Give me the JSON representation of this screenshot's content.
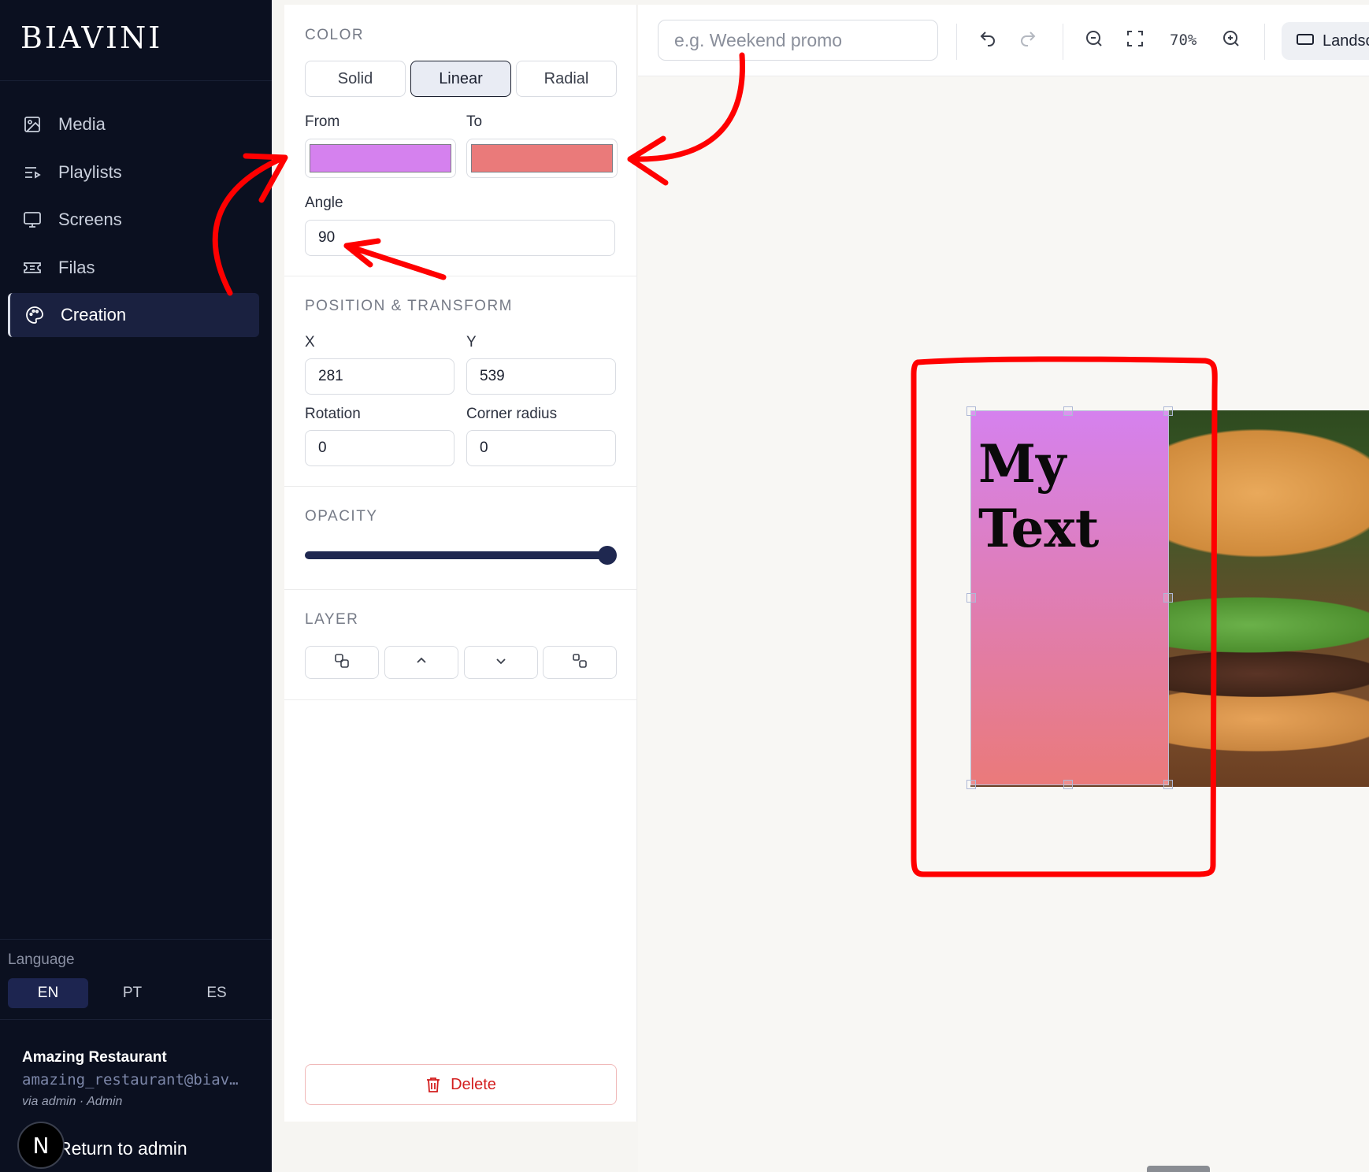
{
  "sidebar": {
    "logo": "BIAVINI",
    "items": [
      {
        "label": "Media",
        "icon": "image-icon"
      },
      {
        "label": "Playlists",
        "icon": "playlist-icon"
      },
      {
        "label": "Screens",
        "icon": "monitor-icon"
      },
      {
        "label": "Filas",
        "icon": "ticket-icon"
      },
      {
        "label": "Creation",
        "icon": "palette-icon",
        "active": true
      }
    ],
    "language": {
      "label": "Language",
      "options": [
        "EN",
        "PT",
        "ES"
      ],
      "selected": "EN"
    },
    "account": {
      "name": "Amazing Restaurant",
      "email": "amazing_restaurant@biav…",
      "role": "via admin · Admin"
    },
    "badge": "N",
    "return_label": "Return to admin"
  },
  "panel": {
    "color": {
      "title": "COLOR",
      "modes": [
        "Solid",
        "Linear",
        "Radial"
      ],
      "selected_mode": "Linear",
      "from_label": "From",
      "to_label": "To",
      "from_color": "#d581ee",
      "to_color": "#ea7a7a",
      "angle_label": "Angle",
      "angle_value": "90"
    },
    "transform": {
      "title": "POSITION & TRANSFORM",
      "x_label": "X",
      "x_value": "281",
      "y_label": "Y",
      "y_value": "539",
      "rotation_label": "Rotation",
      "rotation_value": "0",
      "radius_label": "Corner radius",
      "radius_value": "0"
    },
    "opacity": {
      "title": "OPACITY",
      "value": 1.0
    },
    "layer": {
      "title": "LAYER",
      "buttons": [
        "bring-to-front-icon",
        "chevron-up-icon",
        "chevron-down-icon",
        "send-to-back-icon"
      ]
    },
    "delete_label": "Delete"
  },
  "toolbar": {
    "name_placeholder": "e.g. Weekend promo",
    "zoom": "70%",
    "orientation_label": "Landsc"
  },
  "canvas": {
    "text": "My Text",
    "gradient": {
      "from": "#d581ee",
      "to": "#ea7a7a"
    }
  },
  "colors": {
    "sidebar_bg": "#0b1020",
    "accent": "#1f2850",
    "annotation": "#ff0000",
    "delete": "#d31e1e"
  }
}
